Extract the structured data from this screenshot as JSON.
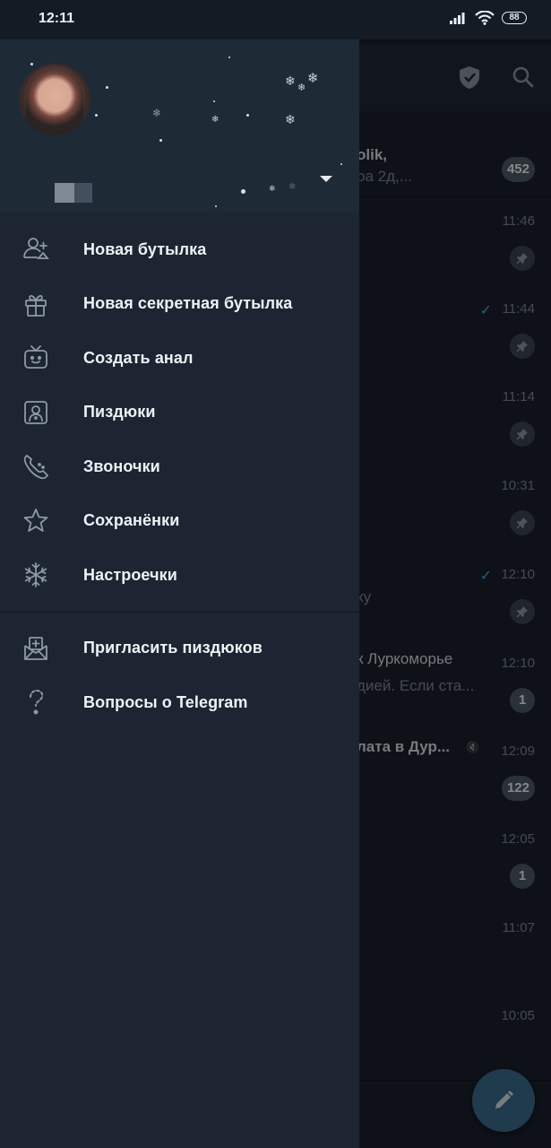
{
  "status_bar": {
    "time": "12:11",
    "battery": "88"
  },
  "chat_list": {
    "rows": [
      {
        "time": "",
        "line1": "olik,",
        "line2": "ра 2д,...",
        "badge": "452"
      },
      {
        "time": "11:46",
        "line1": "",
        "line2": "",
        "pinned": true
      },
      {
        "time": "11:44",
        "line1": "",
        "line2": "",
        "pinned": true,
        "read": true
      },
      {
        "time": "11:14",
        "line1": "",
        "line2": "",
        "pinned": true
      },
      {
        "time": "10:31",
        "line1": "",
        "line2": "",
        "pinned": true
      },
      {
        "time": "12:10",
        "line1": "",
        "line2": "ку",
        "pinned": true,
        "read": true
      },
      {
        "time": "12:10",
        "line1": "к Луркоморье",
        "line2": "дией. Если ста...",
        "badge": "1"
      },
      {
        "time": "12:09",
        "line1": "лата в Дур...",
        "line2": "",
        "badge": "122",
        "muted": true
      },
      {
        "time": "12:05",
        "line1": "",
        "line2": "",
        "badge": "1"
      },
      {
        "time": "11:07",
        "line1": "",
        "line2": ""
      },
      {
        "time": "10:05",
        "line1": "",
        "line2": ""
      }
    ]
  },
  "drawer": {
    "menu": [
      {
        "label": "Новая бутылка",
        "icon": "new-group-icon"
      },
      {
        "label": "Новая секретная бутылка",
        "icon": "gift-icon"
      },
      {
        "label": "Создать анал",
        "icon": "tv-channel-icon"
      },
      {
        "label": "Пиздюки",
        "icon": "contacts-icon"
      },
      {
        "label": "Звоночки",
        "icon": "calls-icon"
      },
      {
        "label": "Сохранёнки",
        "icon": "star-icon"
      },
      {
        "label": "Настроечки",
        "icon": "snowflake-icon"
      }
    ],
    "secondary_menu": [
      {
        "label": "Пригласить пиздюков",
        "icon": "invite-envelope-icon"
      },
      {
        "label": "Вопросы о Telegram",
        "icon": "candy-cane-question-icon"
      }
    ]
  },
  "colors": {
    "drawer_bg": "#1c2531",
    "header_bg": "#1f2a37",
    "accent": "#4da3e6",
    "fab": "#3b6a8f"
  }
}
